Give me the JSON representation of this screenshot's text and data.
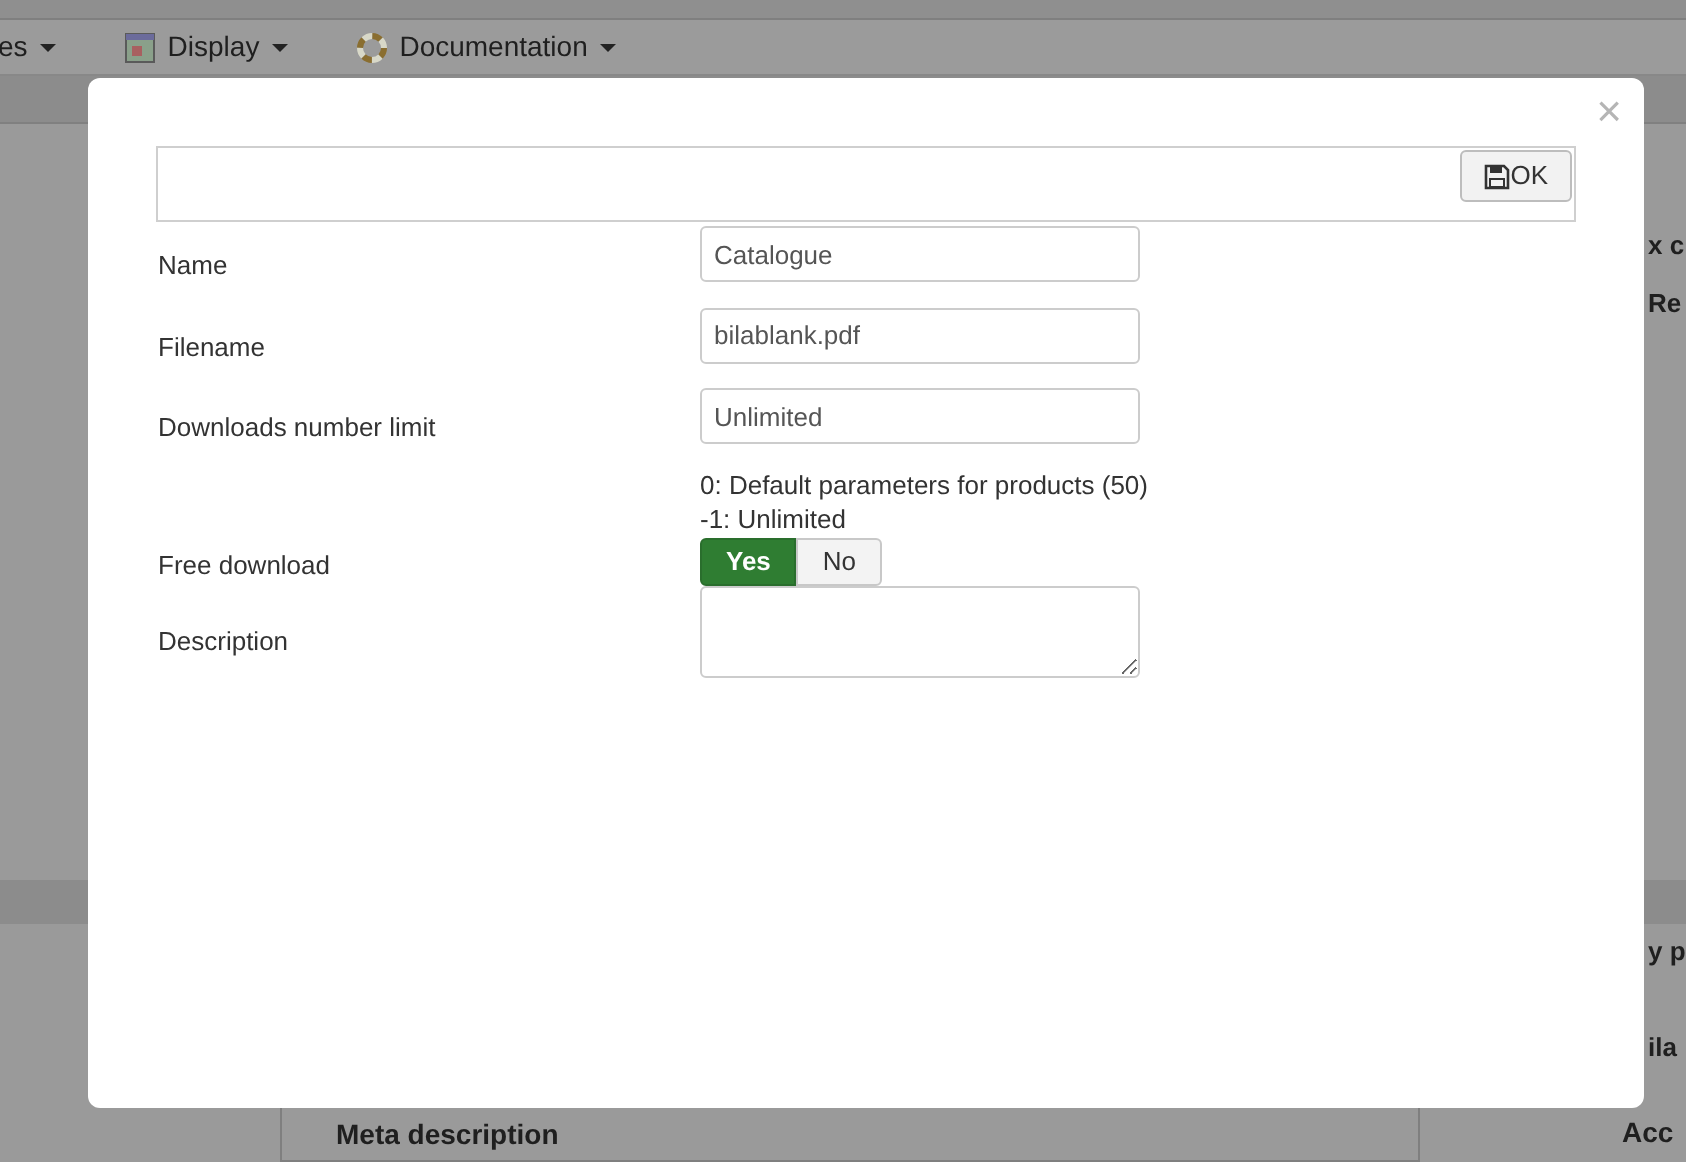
{
  "menu": [
    {
      "label": "es"
    },
    {
      "label": "Display"
    },
    {
      "label": "Documentation"
    }
  ],
  "background_fragments": {
    "right_top": [
      "x c",
      "Re"
    ],
    "right_bottom": [
      "y p",
      "ila"
    ],
    "bottom_right": "Acc",
    "meta_label": "Meta description"
  },
  "dialog": {
    "close": "×",
    "toolbar": {
      "ok_button": "OK"
    },
    "fields": [
      {
        "kind": "text",
        "label": "Name",
        "value": "Catalogue"
      },
      {
        "kind": "text",
        "label": "Filename",
        "value": "bilablank.pdf"
      },
      {
        "kind": "text",
        "label": "Downloads number limit",
        "value": "Unlimited",
        "help": [
          "0: Default parameters for products (50)",
          "-1: Unlimited"
        ]
      },
      {
        "kind": "toggle",
        "label": "Free download",
        "options": [
          {
            "label": "Yes",
            "selected": true
          },
          {
            "label": "No",
            "selected": false
          }
        ]
      },
      {
        "kind": "textarea",
        "label": "Description"
      }
    ]
  }
}
